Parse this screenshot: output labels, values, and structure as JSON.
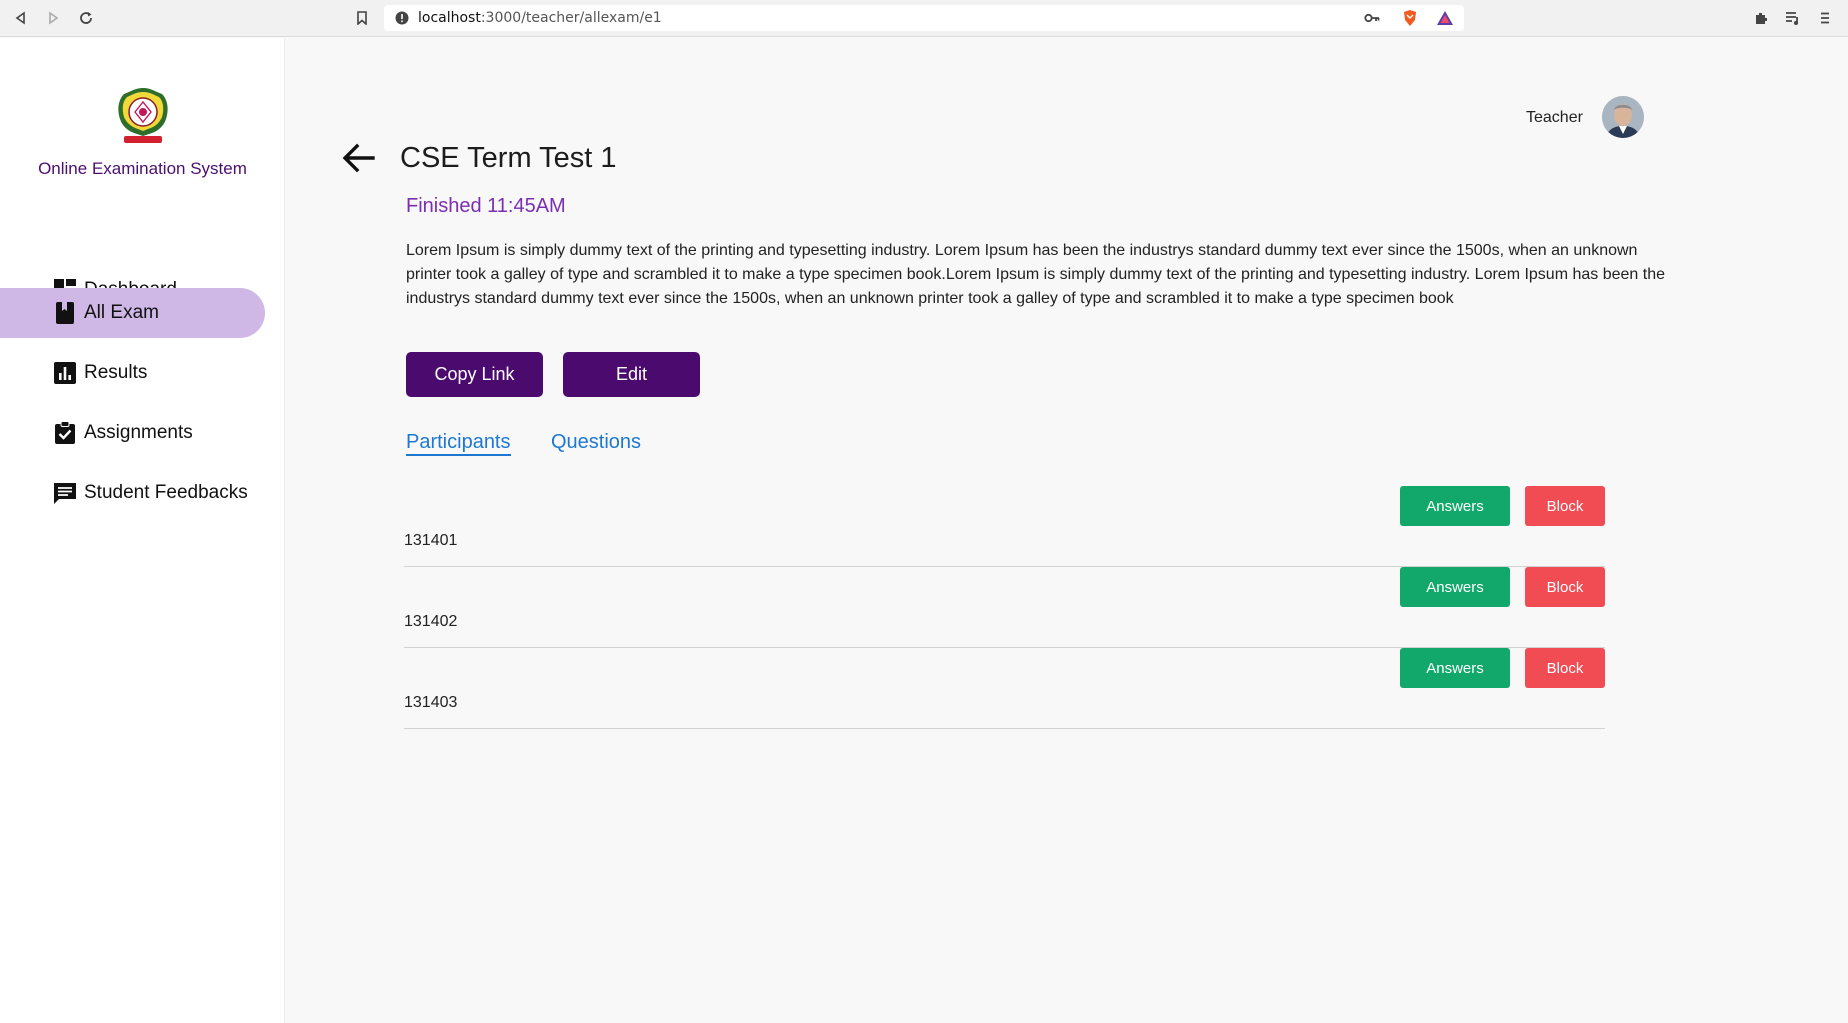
{
  "browser": {
    "url_host": "localhost",
    "url_path": ":3000/teacher/allexam/e1"
  },
  "sidebar": {
    "brand": "Online Examination System",
    "items": [
      {
        "label": "Dashboard",
        "icon": "dashboard-icon",
        "active": false
      },
      {
        "label": "All Exam",
        "icon": "book-icon",
        "active": true
      },
      {
        "label": "Results",
        "icon": "bar-chart-icon",
        "active": false
      },
      {
        "label": "Assignments",
        "icon": "clipboard-check-icon",
        "active": false
      },
      {
        "label": "Student Feedbacks",
        "icon": "feedback-icon",
        "active": false
      }
    ]
  },
  "header": {
    "user_name": "Teacher"
  },
  "exam": {
    "title": "CSE Term Test 1",
    "status": "Finished 11:45AM",
    "description": "Lorem Ipsum is simply dummy text of the printing and typesetting industry. Lorem Ipsum has been the industrys standard dummy text ever since the 1500s, when an unknown printer took a galley of type and scrambled it to make a type specimen book.Lorem Ipsum is simply dummy text of the printing and typesetting industry. Lorem Ipsum has been the industrys standard dummy text ever since the 1500s, when an unknown printer took a galley of type and scrambled it to make a type specimen book",
    "copy_link_label": "Copy Link",
    "edit_label": "Edit"
  },
  "tabs": [
    {
      "label": "Participants",
      "active": true
    },
    {
      "label": "Questions",
      "active": false
    }
  ],
  "participants": [
    {
      "id": "131401",
      "answers_label": "Answers",
      "block_label": "Block"
    },
    {
      "id": "131402",
      "answers_label": "Answers",
      "block_label": "Block"
    },
    {
      "id": "131403",
      "answers_label": "Answers",
      "block_label": "Block"
    }
  ],
  "colors": {
    "brand_purple": "#4b0a6e",
    "active_menu": "#cfb8e6",
    "status_purple": "#7b2fb0",
    "tab_blue": "#1e78d2",
    "answers_green": "#13a86b",
    "block_red": "#f14b53"
  }
}
